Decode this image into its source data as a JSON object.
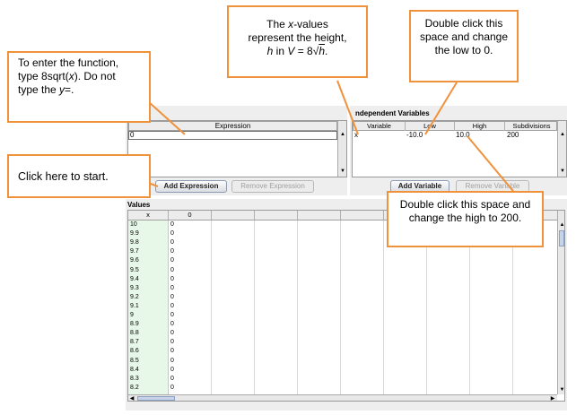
{
  "expressions_panel": {
    "header": "Expression",
    "value": "0",
    "add_button": "Add Expression",
    "remove_button": "Remove Expression"
  },
  "variables_panel": {
    "title": "ndependent Variables",
    "headers": [
      "Variable",
      "Low",
      "High",
      "Subdivisions"
    ],
    "row": {
      "variable": "x",
      "low": "-10.0",
      "high": "10.0",
      "subdivisions": "200"
    },
    "add_button": "Add Variable",
    "remove_button": "Remove Variable"
  },
  "values_panel": {
    "title": "Values",
    "headers": [
      "x",
      "0"
    ],
    "x_values": [
      "10",
      "9.9",
      "9.8",
      "9.7",
      "9.6",
      "9.5",
      "9.4",
      "9.3",
      "9.2",
      "9.1",
      "9",
      "8.9",
      "8.8",
      "8.7",
      "8.6",
      "8.5",
      "8.4",
      "8.3",
      "8.2"
    ],
    "y_value": "0"
  },
  "callouts": {
    "function": {
      "line1": "To enter the function,",
      "line2a": "type 8sqrt(",
      "line2i": "x",
      "line2b": "). Do not",
      "line3a": "type the ",
      "line3i": "y",
      "line3b": "=."
    },
    "start": "Click here to start.",
    "xvalues": {
      "line1a": "The ",
      "line1i": "x",
      "line1b": "-values",
      "line2": "represent the height,",
      "line3i1": "h",
      "line3a": " in ",
      "line3i2": "V",
      "line3b": " = 8√",
      "line3i3": "h",
      "line3c": "."
    },
    "low": "Double click this space and change the low to 0.",
    "high": "Double click this space and change the high to 200."
  },
  "colors": {
    "callout_border": "#f0913b",
    "x_column_bg": "#e8f8e8"
  },
  "icons": [
    "scroll-up-icon",
    "scroll-down-icon",
    "scroll-left-icon",
    "scroll-right-icon"
  ]
}
